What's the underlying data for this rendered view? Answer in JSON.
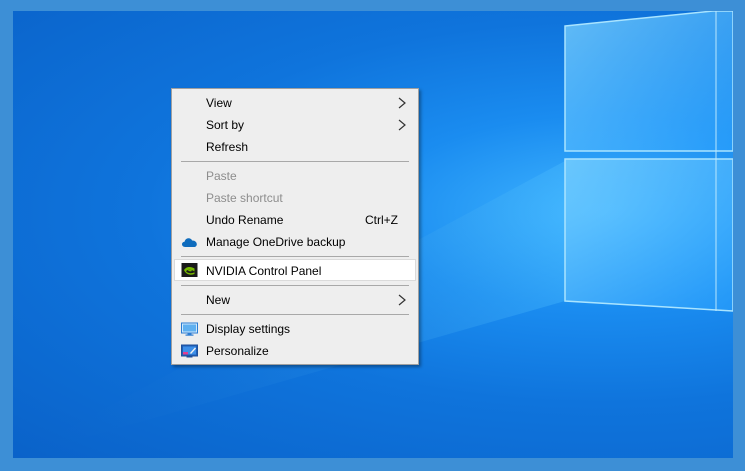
{
  "menu": {
    "items": [
      {
        "label": "View",
        "submenu": true
      },
      {
        "label": "Sort by",
        "submenu": true
      },
      {
        "label": "Refresh"
      },
      {
        "label": "Paste",
        "disabled": true
      },
      {
        "label": "Paste shortcut",
        "disabled": true
      },
      {
        "label": "Undo Rename",
        "shortcut": "Ctrl+Z"
      },
      {
        "label": "Manage OneDrive backup",
        "icon": "onedrive-cloud-icon"
      },
      {
        "label": "NVIDIA Control Panel",
        "icon": "nvidia-icon",
        "highlighted": true
      },
      {
        "label": "New",
        "submenu": true
      },
      {
        "label": "Display settings",
        "icon": "display-monitor-icon"
      },
      {
        "label": "Personalize",
        "icon": "personalize-icon"
      }
    ]
  },
  "colors": {
    "desktop_blue": "#0f74dc",
    "menu_background": "#eeeeee",
    "disabled_text": "#8d8d8d",
    "onedrive_blue": "#0f6cbd",
    "nvidia_green": "#76b900"
  }
}
